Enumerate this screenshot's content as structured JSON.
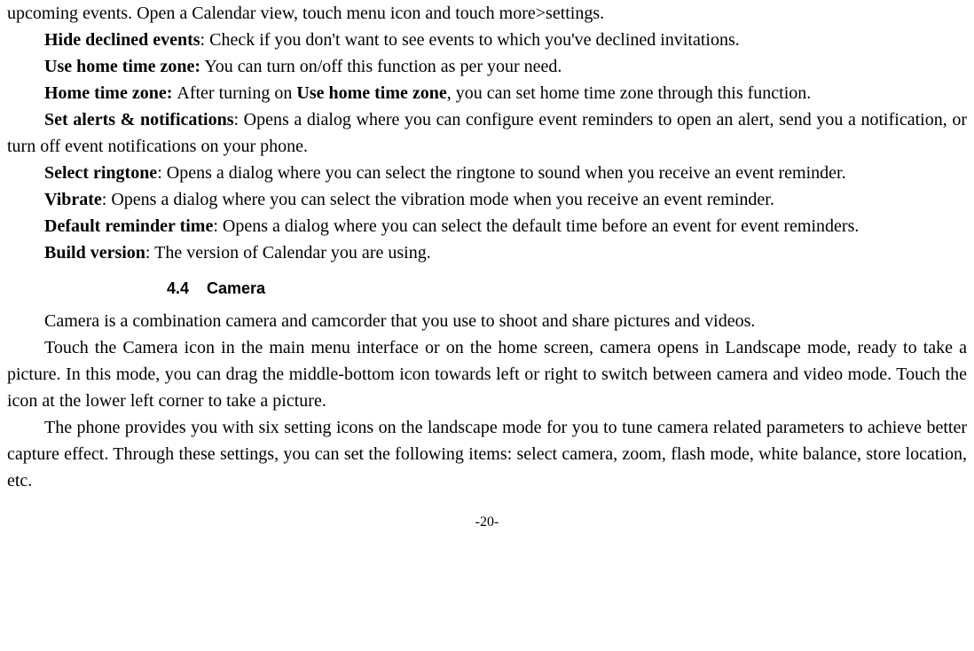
{
  "paragraphs": {
    "upcoming": "upcoming events. Open a Calendar view, touch menu icon and touch more>settings.",
    "hide_b": "Hide declined events",
    "hide_t": ": Check if you don't want to see events to which you've declined invitations.",
    "usehome_b": "Use home time zone:",
    "usehome_t": " You can turn on/off this function as per your need.",
    "hometz_b1": "Home time zone: ",
    "hometz_t1": "After turning on ",
    "hometz_b2": "Use home time zone",
    "hometz_t2": ", you can set home time zone through this function.",
    "alerts_b": "Set alerts & notifications",
    "alerts_t": ": Opens a dialog where you can configure event reminders to open an alert, send you a notification, or turn off event notifications on your phone.",
    "ring_b": "Select ringtone",
    "ring_t": ": Opens a dialog where you can select the ringtone to sound when you receive an event reminder.",
    "vib_b": "Vibrate",
    "vib_t": ": Opens a dialog where you can select the vibration mode when you receive an event reminder.",
    "defrem_b": "Default reminder time",
    "defrem_t": ": Opens a dialog where you can select the default time before an event for event reminders.",
    "build_b": "Build version",
    "build_t": ": The version of Calendar you are using."
  },
  "section": {
    "num": "4.4",
    "title": "Camera"
  },
  "camera": {
    "p1": "Camera is a combination camera and camcorder that you use to shoot and share pictures and videos.",
    "p2": "Touch the Camera icon in the main menu interface or on the home screen, camera opens in Landscape mode, ready to take a picture. In this mode, you can drag the middle-bottom icon towards left or right to switch between camera and video mode. Touch the icon at the lower left corner to take a picture.",
    "p3": " The phone provides you with six setting icons on the landscape mode for you to tune camera related parameters to achieve better capture effect. Through these settings, you can set the following items: select camera, zoom, flash mode, white balance, store location, etc."
  },
  "footer": "-20-"
}
